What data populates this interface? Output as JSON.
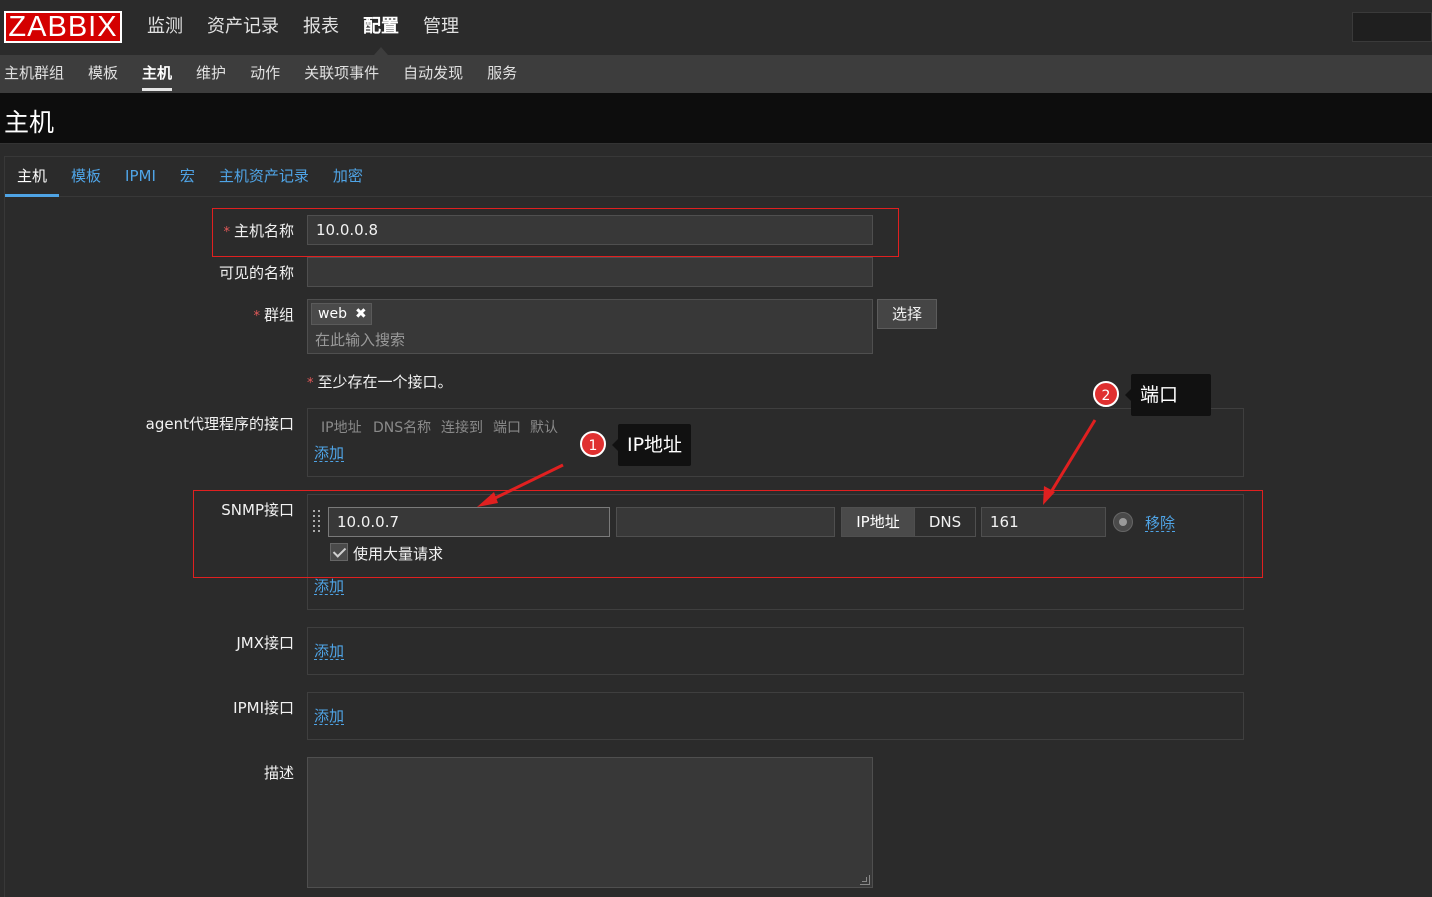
{
  "app": {
    "logo": "ZABBIX"
  },
  "main_menu": [
    "监测",
    "资产记录",
    "报表",
    "配置",
    "管理"
  ],
  "sub_menu": [
    "主机群组",
    "模板",
    "主机",
    "维护",
    "动作",
    "关联项事件",
    "自动发现",
    "服务"
  ],
  "page_title": "主机",
  "tabs": [
    "主机",
    "模板",
    "IPMI",
    "宏",
    "主机资产记录",
    "加密"
  ],
  "form": {
    "host_name_label": "主机名称",
    "host_name_value": "10.0.0.8",
    "visible_name_label": "可见的名称",
    "visible_name_value": "",
    "groups_label": "群组",
    "group_tag": "web",
    "groups_placeholder": "在此输入搜索",
    "select_button": "选择",
    "interface_note": "至少存在一个接口。",
    "agent_label": "agent代理程序的接口",
    "interface_columns": [
      "IP地址",
      "DNS名称",
      "连接到",
      "端口",
      "默认"
    ],
    "add_link": "添加",
    "snmp_label": "SNMP接口",
    "snmp_ip": "10.0.0.7",
    "snmp_dns": "",
    "connect_ip": "IP地址",
    "connect_dns": "DNS",
    "snmp_port": "161",
    "remove_link": "移除",
    "bulk_label": "使用大量请求",
    "jmx_label": "JMX接口",
    "ipmi_label": "IPMI接口",
    "description_label": "描述",
    "required_mark": "*"
  },
  "annotations": [
    {
      "number": "1",
      "text": "IP地址"
    },
    {
      "number": "2",
      "text": "端口"
    }
  ],
  "colors": {
    "accent": "#4fa4e6",
    "annotation_red": "#e02020",
    "logo_red": "#d40000"
  }
}
